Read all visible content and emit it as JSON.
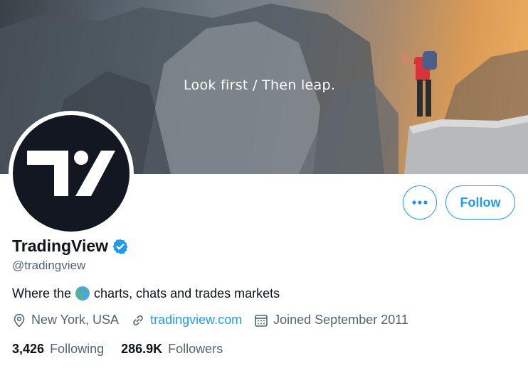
{
  "banner": {
    "tagline": "Look first / Then leap."
  },
  "profile": {
    "display_name": "TradingView",
    "handle": "@tradingview",
    "bio_before": "Where the",
    "bio_after": "charts, chats and trades markets",
    "location": "New York, USA",
    "website": "tradingview.com",
    "joined": "Joined September 2011"
  },
  "actions": {
    "follow_label": "Follow"
  },
  "stats": {
    "following_count": "3,426",
    "following_label": "Following",
    "followers_count": "286.9K",
    "followers_label": "Followers"
  },
  "icons": {
    "avatar_logo": "tradingview-logo",
    "verified": "verified-badge-icon",
    "more": "more-options-icon",
    "location": "location-pin-icon",
    "link": "link-icon",
    "calendar": "calendar-icon",
    "globe": "globe-emoji-icon"
  },
  "colors": {
    "accent": "#1d9bf0",
    "text_primary": "#0f1419",
    "text_secondary": "#536471",
    "avatar_bg": "#131722"
  }
}
